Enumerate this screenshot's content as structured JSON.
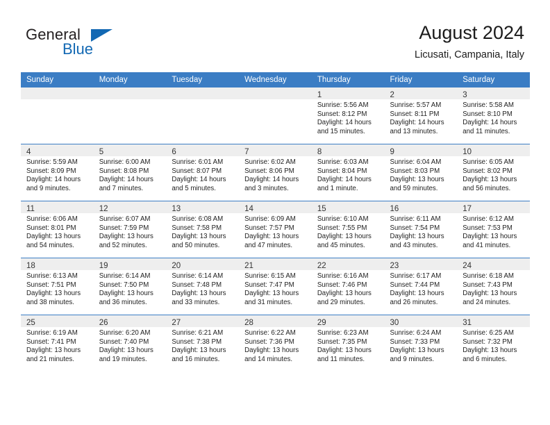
{
  "brand": {
    "name_top": "General",
    "name_bottom": "Blue",
    "accent_color": "#1268b3"
  },
  "header": {
    "title": "August 2024",
    "subtitle": "Licusati, Campania, Italy"
  },
  "theme": {
    "header_bg": "#3b7dc4",
    "daynum_bg": "#eeeeee",
    "grid_line": "#3b7dc4"
  },
  "weekdays": [
    "Sunday",
    "Monday",
    "Tuesday",
    "Wednesday",
    "Thursday",
    "Friday",
    "Saturday"
  ],
  "labels": {
    "sunrise_prefix": "Sunrise:",
    "sunset_prefix": "Sunset:",
    "daylight_prefix": "Daylight:"
  },
  "weeks": [
    [
      {
        "day": "",
        "empty": true
      },
      {
        "day": "",
        "empty": true
      },
      {
        "day": "",
        "empty": true
      },
      {
        "day": "",
        "empty": true
      },
      {
        "day": "1",
        "sunrise": "Sunrise: 5:56 AM",
        "sunset": "Sunset: 8:12 PM",
        "daylight1": "Daylight: 14 hours",
        "daylight2": "and 15 minutes."
      },
      {
        "day": "2",
        "sunrise": "Sunrise: 5:57 AM",
        "sunset": "Sunset: 8:11 PM",
        "daylight1": "Daylight: 14 hours",
        "daylight2": "and 13 minutes."
      },
      {
        "day": "3",
        "sunrise": "Sunrise: 5:58 AM",
        "sunset": "Sunset: 8:10 PM",
        "daylight1": "Daylight: 14 hours",
        "daylight2": "and 11 minutes."
      }
    ],
    [
      {
        "day": "4",
        "sunrise": "Sunrise: 5:59 AM",
        "sunset": "Sunset: 8:09 PM",
        "daylight1": "Daylight: 14 hours",
        "daylight2": "and 9 minutes."
      },
      {
        "day": "5",
        "sunrise": "Sunrise: 6:00 AM",
        "sunset": "Sunset: 8:08 PM",
        "daylight1": "Daylight: 14 hours",
        "daylight2": "and 7 minutes."
      },
      {
        "day": "6",
        "sunrise": "Sunrise: 6:01 AM",
        "sunset": "Sunset: 8:07 PM",
        "daylight1": "Daylight: 14 hours",
        "daylight2": "and 5 minutes."
      },
      {
        "day": "7",
        "sunrise": "Sunrise: 6:02 AM",
        "sunset": "Sunset: 8:06 PM",
        "daylight1": "Daylight: 14 hours",
        "daylight2": "and 3 minutes."
      },
      {
        "day": "8",
        "sunrise": "Sunrise: 6:03 AM",
        "sunset": "Sunset: 8:04 PM",
        "daylight1": "Daylight: 14 hours",
        "daylight2": "and 1 minute."
      },
      {
        "day": "9",
        "sunrise": "Sunrise: 6:04 AM",
        "sunset": "Sunset: 8:03 PM",
        "daylight1": "Daylight: 13 hours",
        "daylight2": "and 59 minutes."
      },
      {
        "day": "10",
        "sunrise": "Sunrise: 6:05 AM",
        "sunset": "Sunset: 8:02 PM",
        "daylight1": "Daylight: 13 hours",
        "daylight2": "and 56 minutes."
      }
    ],
    [
      {
        "day": "11",
        "sunrise": "Sunrise: 6:06 AM",
        "sunset": "Sunset: 8:01 PM",
        "daylight1": "Daylight: 13 hours",
        "daylight2": "and 54 minutes."
      },
      {
        "day": "12",
        "sunrise": "Sunrise: 6:07 AM",
        "sunset": "Sunset: 7:59 PM",
        "daylight1": "Daylight: 13 hours",
        "daylight2": "and 52 minutes."
      },
      {
        "day": "13",
        "sunrise": "Sunrise: 6:08 AM",
        "sunset": "Sunset: 7:58 PM",
        "daylight1": "Daylight: 13 hours",
        "daylight2": "and 50 minutes."
      },
      {
        "day": "14",
        "sunrise": "Sunrise: 6:09 AM",
        "sunset": "Sunset: 7:57 PM",
        "daylight1": "Daylight: 13 hours",
        "daylight2": "and 47 minutes."
      },
      {
        "day": "15",
        "sunrise": "Sunrise: 6:10 AM",
        "sunset": "Sunset: 7:55 PM",
        "daylight1": "Daylight: 13 hours",
        "daylight2": "and 45 minutes."
      },
      {
        "day": "16",
        "sunrise": "Sunrise: 6:11 AM",
        "sunset": "Sunset: 7:54 PM",
        "daylight1": "Daylight: 13 hours",
        "daylight2": "and 43 minutes."
      },
      {
        "day": "17",
        "sunrise": "Sunrise: 6:12 AM",
        "sunset": "Sunset: 7:53 PM",
        "daylight1": "Daylight: 13 hours",
        "daylight2": "and 41 minutes."
      }
    ],
    [
      {
        "day": "18",
        "sunrise": "Sunrise: 6:13 AM",
        "sunset": "Sunset: 7:51 PM",
        "daylight1": "Daylight: 13 hours",
        "daylight2": "and 38 minutes."
      },
      {
        "day": "19",
        "sunrise": "Sunrise: 6:14 AM",
        "sunset": "Sunset: 7:50 PM",
        "daylight1": "Daylight: 13 hours",
        "daylight2": "and 36 minutes."
      },
      {
        "day": "20",
        "sunrise": "Sunrise: 6:14 AM",
        "sunset": "Sunset: 7:48 PM",
        "daylight1": "Daylight: 13 hours",
        "daylight2": "and 33 minutes."
      },
      {
        "day": "21",
        "sunrise": "Sunrise: 6:15 AM",
        "sunset": "Sunset: 7:47 PM",
        "daylight1": "Daylight: 13 hours",
        "daylight2": "and 31 minutes."
      },
      {
        "day": "22",
        "sunrise": "Sunrise: 6:16 AM",
        "sunset": "Sunset: 7:46 PM",
        "daylight1": "Daylight: 13 hours",
        "daylight2": "and 29 minutes."
      },
      {
        "day": "23",
        "sunrise": "Sunrise: 6:17 AM",
        "sunset": "Sunset: 7:44 PM",
        "daylight1": "Daylight: 13 hours",
        "daylight2": "and 26 minutes."
      },
      {
        "day": "24",
        "sunrise": "Sunrise: 6:18 AM",
        "sunset": "Sunset: 7:43 PM",
        "daylight1": "Daylight: 13 hours",
        "daylight2": "and 24 minutes."
      }
    ],
    [
      {
        "day": "25",
        "sunrise": "Sunrise: 6:19 AM",
        "sunset": "Sunset: 7:41 PM",
        "daylight1": "Daylight: 13 hours",
        "daylight2": "and 21 minutes."
      },
      {
        "day": "26",
        "sunrise": "Sunrise: 6:20 AM",
        "sunset": "Sunset: 7:40 PM",
        "daylight1": "Daylight: 13 hours",
        "daylight2": "and 19 minutes."
      },
      {
        "day": "27",
        "sunrise": "Sunrise: 6:21 AM",
        "sunset": "Sunset: 7:38 PM",
        "daylight1": "Daylight: 13 hours",
        "daylight2": "and 16 minutes."
      },
      {
        "day": "28",
        "sunrise": "Sunrise: 6:22 AM",
        "sunset": "Sunset: 7:36 PM",
        "daylight1": "Daylight: 13 hours",
        "daylight2": "and 14 minutes."
      },
      {
        "day": "29",
        "sunrise": "Sunrise: 6:23 AM",
        "sunset": "Sunset: 7:35 PM",
        "daylight1": "Daylight: 13 hours",
        "daylight2": "and 11 minutes."
      },
      {
        "day": "30",
        "sunrise": "Sunrise: 6:24 AM",
        "sunset": "Sunset: 7:33 PM",
        "daylight1": "Daylight: 13 hours",
        "daylight2": "and 9 minutes."
      },
      {
        "day": "31",
        "sunrise": "Sunrise: 6:25 AM",
        "sunset": "Sunset: 7:32 PM",
        "daylight1": "Daylight: 13 hours",
        "daylight2": "and 6 minutes."
      }
    ]
  ]
}
